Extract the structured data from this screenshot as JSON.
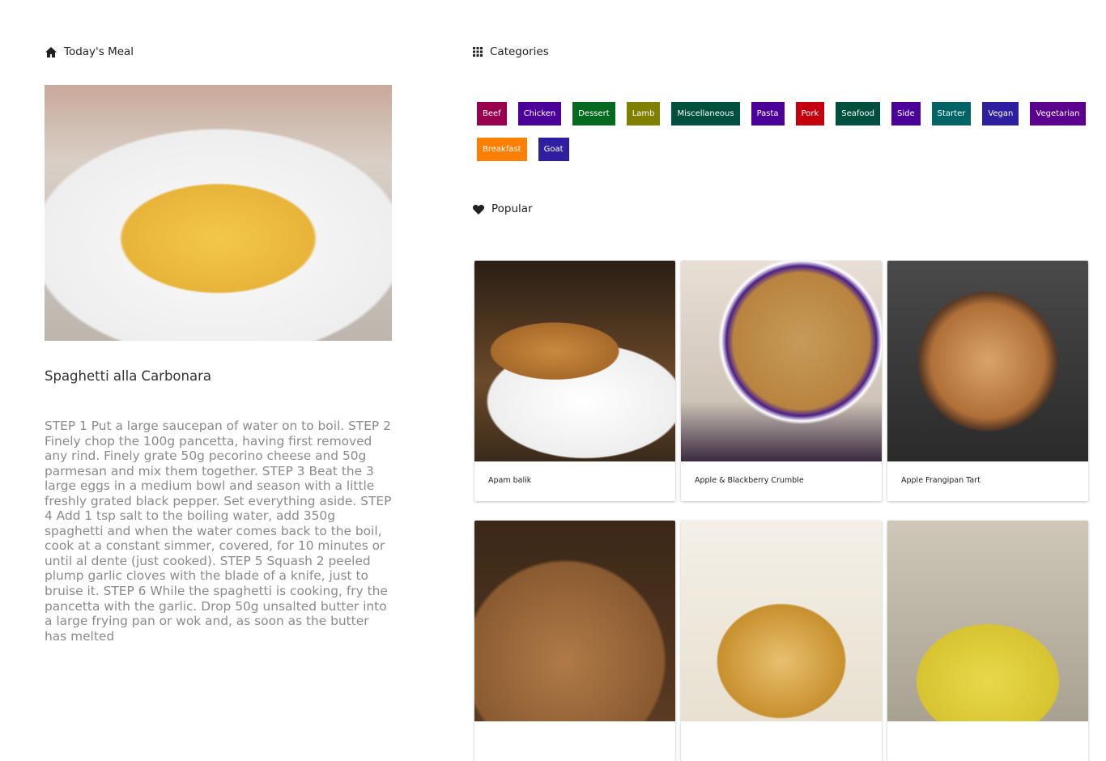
{
  "todays_meal": {
    "heading": "Today's Meal",
    "title": "Spaghetti alla Carbonara",
    "instructions": "STEP 1 Put a large saucepan of water on to boil. STEP 2 Finely chop the 100g pancetta, having first removed any rind. Finely grate 50g pecorino cheese and 50g parmesan and mix them together. STEP 3 Beat the 3 large eggs in a medium bowl and season with a little freshly grated black pepper. Set everything aside. STEP 4 Add 1 tsp salt to the boiling water, add 350g spaghetti and when the water comes back to the boil, cook at a constant simmer, covered, for 10 minutes or until al dente (just cooked). STEP 5 Squash 2 peeled plump garlic cloves with the blade of a knife, just to bruise it. STEP 6 While the spaghetti is cooking, fry the pancetta with the garlic. Drop 50g unsalted butter into a large frying pan or wok and, as soon as the butter has melted"
  },
  "categories": {
    "heading": "Categories",
    "items": [
      {
        "label": "Beef",
        "color": "#9a0050"
      },
      {
        "label": "Chicken",
        "color": "#4a0099"
      },
      {
        "label": "Dessert",
        "color": "#05691f"
      },
      {
        "label": "Lamb",
        "color": "#7f7f00"
      },
      {
        "label": "Miscellaneous",
        "color": "#005040"
      },
      {
        "label": "Pasta",
        "color": "#4a0099"
      },
      {
        "label": "Pork",
        "color": "#c4000f"
      },
      {
        "label": "Seafood",
        "color": "#005040"
      },
      {
        "label": "Side",
        "color": "#4a0099"
      },
      {
        "label": "Starter",
        "color": "#006466"
      },
      {
        "label": "Vegan",
        "color": "#2d1fa0"
      },
      {
        "label": "Vegetarian",
        "color": "#5c0090"
      },
      {
        "label": "Breakfast",
        "color": "#ff7f00"
      },
      {
        "label": "Goat",
        "color": "#2d1fa0"
      }
    ]
  },
  "popular": {
    "heading": "Popular",
    "items": [
      {
        "label": "Apam balik"
      },
      {
        "label": "Apple & Blackberry Crumble"
      },
      {
        "label": "Apple Frangipan Tart"
      },
      {
        "label": ""
      },
      {
        "label": ""
      },
      {
        "label": ""
      }
    ]
  }
}
